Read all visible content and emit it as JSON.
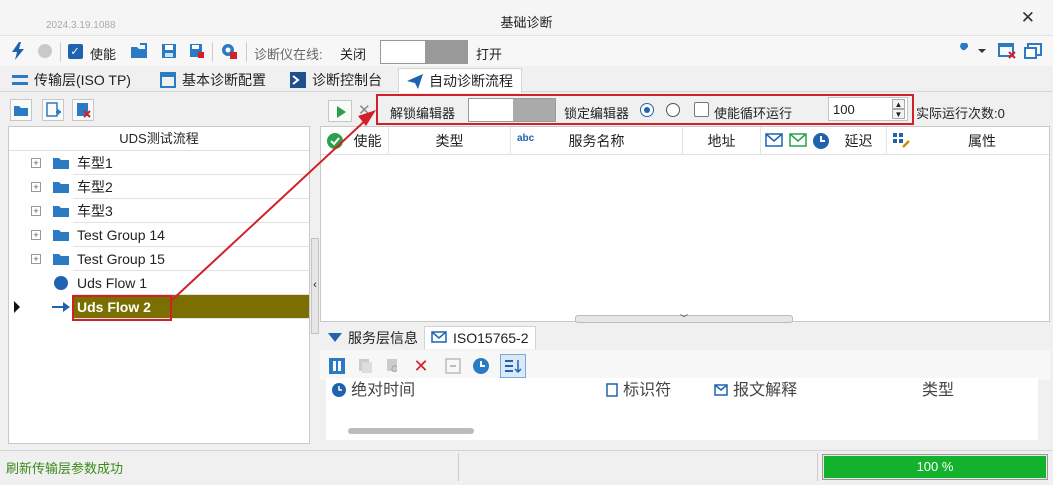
{
  "window": {
    "version": "2024.3.19.1088",
    "title": "基础诊断",
    "close": "✕"
  },
  "toolbar": {
    "enable_label": "使能",
    "tester_online_label": "诊断仪在线:",
    "off_label": "关闭",
    "on_label": "打开"
  },
  "tabs": [
    {
      "label": "传输层(ISO TP)",
      "icon": "transport-icon"
    },
    {
      "label": "基本诊断配置",
      "icon": "config-icon"
    },
    {
      "label": "诊断控制台",
      "icon": "console-icon"
    },
    {
      "label": "自动诊断流程",
      "icon": "auto-flow-icon",
      "active": true
    }
  ],
  "tree": {
    "title": "UDS测试流程",
    "items": [
      {
        "label": "车型1",
        "type": "folder"
      },
      {
        "label": "车型2",
        "type": "folder"
      },
      {
        "label": "车型3",
        "type": "folder"
      },
      {
        "label": "Test Group 14",
        "type": "folder"
      },
      {
        "label": "Test Group 15",
        "type": "folder"
      },
      {
        "label": "Uds Flow 1",
        "type": "flow"
      },
      {
        "label": "Uds Flow 2",
        "type": "flow-current",
        "selected": true
      }
    ]
  },
  "flow_toolbar": {
    "unlock_editor": "解锁编辑器",
    "lock_editor": "锁定编辑器",
    "enable_loop": "使能循环运行",
    "loop_count": "100",
    "actual_runs": "实际运行次数:0"
  },
  "grid": {
    "columns": [
      "使能",
      "类型",
      "服务名称",
      "地址",
      "延迟",
      "属性"
    ],
    "abc_icon": "abc"
  },
  "bottom_tabs": [
    {
      "label": "服务层信息",
      "icon": "service-layer-icon"
    },
    {
      "label": "ISO15765-2",
      "icon": "mail-icon",
      "active": true
    }
  ],
  "log": {
    "columns": [
      "绝对时间",
      "标识符",
      "报文解释",
      "类型"
    ]
  },
  "status": {
    "message": "刷新传输层参数成功",
    "progress": 1.0,
    "progress_text": "100 %"
  },
  "colors": {
    "accent": "#1f63b0",
    "highlight_red": "#d2202a",
    "selected_row": "#7a6f00",
    "progress_green": "#13b22c",
    "status_text_green": "#3b8a1b"
  }
}
